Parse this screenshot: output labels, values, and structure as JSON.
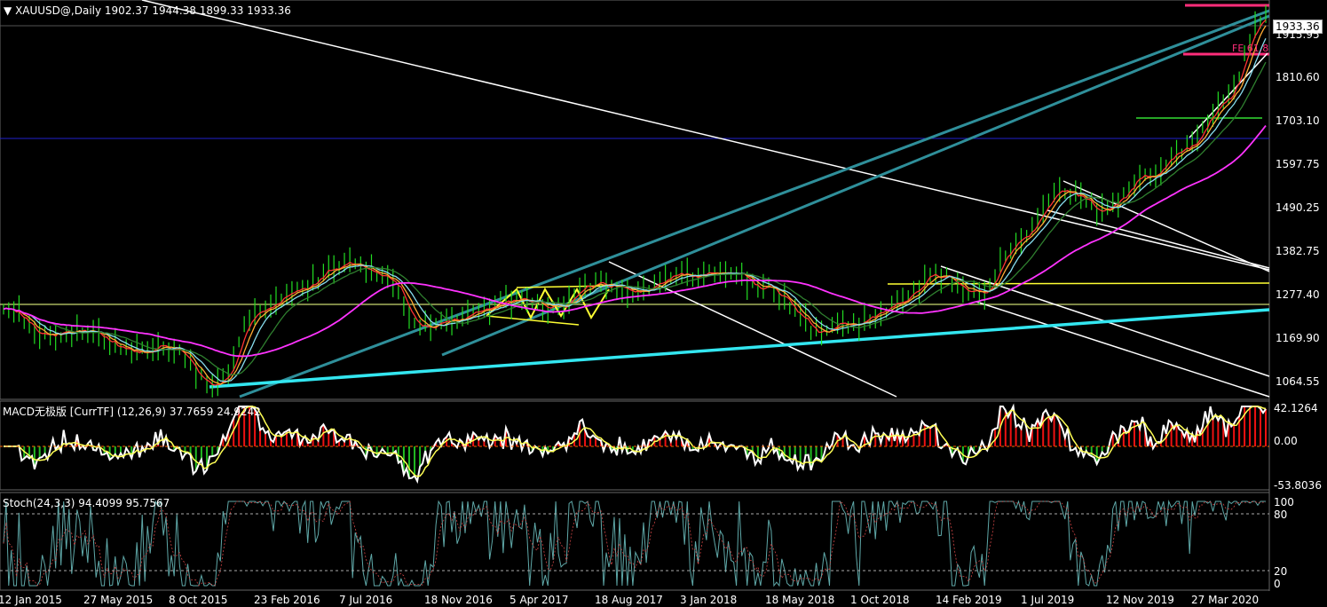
{
  "header": {
    "symbol_line": "XAUUSD@,Daily  1902.37 1944.38 1899.33 1933.36",
    "macd_label": "MACD无极版 [CurrTF] (12,26,9) 37.7659 24.9242",
    "stoch_label": "Stoch(24,3,3) 94.4099 95.7567"
  },
  "price_panel": {
    "last_price_tag": "1933.36",
    "axis_labels": [
      "1915.95",
      "1810.60",
      "1703.10",
      "1597.75",
      "1490.25",
      "1382.75",
      "1277.40",
      "1169.90",
      "1064.55"
    ],
    "fe_label": "FE 61.8"
  },
  "macd_panel": {
    "axis_labels": [
      "42.1264",
      "0.00",
      "-53.8036"
    ]
  },
  "stoch_panel": {
    "axis_labels": [
      "100",
      "80",
      "20",
      "0"
    ]
  },
  "time_axis": [
    "12 Jan 2015",
    "27 May 2015",
    "8 Oct 2015",
    "23 Feb 2016",
    "7 Jul 2016",
    "18 Nov 2016",
    "5 Apr 2017",
    "18 Aug 2017",
    "3 Jan 2018",
    "18 May 2018",
    "1 Oct 2018",
    "14 Feb 2019",
    "1 Jul 2019",
    "12 Nov 2019",
    "27 Mar 2020"
  ],
  "colors": {
    "background": "#000000",
    "candle_up": "#22dd22",
    "ma_magenta": "#ff33ff",
    "trend_white": "#ffffff",
    "channel_teal": "#2f8f9a",
    "support_cyan": "#33e6f0",
    "level_yellow": "#ffff33",
    "level_blue": "#2222cc",
    "fe_pink": "#ff2d7a",
    "macd_hist_pos": "#ee1111",
    "macd_hist_neg": "#22bb22",
    "stoch_line": "#5fa8a8"
  },
  "chart_data": {
    "type": "line",
    "symbol": "XAUUSD",
    "timeframe": "Daily",
    "ohlc_last": {
      "open": 1902.37,
      "high": 1944.38,
      "low": 1899.33,
      "close": 1933.36
    },
    "x": [
      "2015-01-12",
      "2015-03-15",
      "2015-05-27",
      "2015-08-01",
      "2015-10-08",
      "2015-12-17",
      "2016-02-23",
      "2016-05-01",
      "2016-07-07",
      "2016-09-10",
      "2016-11-18",
      "2017-01-25",
      "2017-04-05",
      "2017-06-15",
      "2017-08-18",
      "2017-10-25",
      "2018-01-03",
      "2018-03-10",
      "2018-05-18",
      "2018-08-15",
      "2018-10-01",
      "2018-12-10",
      "2019-02-14",
      "2019-04-25",
      "2019-07-01",
      "2019-09-05",
      "2019-11-12",
      "2020-01-20",
      "2020-03-27",
      "2020-05-20",
      "2020-07-27"
    ],
    "series": [
      {
        "values": [
          1255,
          1180,
          1195,
          1140,
          1150,
          1060,
          1230,
          1290,
          1350,
          1320,
          1200,
          1225,
          1260,
          1250,
          1300,
          1285,
          1315,
          1330,
          1290,
          1190,
          1200,
          1250,
          1320,
          1280,
          1410,
          1520,
          1470,
          1560,
          1620,
          1730,
          1933
        ]
      }
    ],
    "ylim": [
      1040,
      1945
    ],
    "ytick_labels": [
      "1915.95",
      "1810.60",
      "1703.10",
      "1597.75",
      "1490.25",
      "1382.75",
      "1277.40",
      "1169.90",
      "1064.55"
    ],
    "macd": {
      "params": "(12,26,9)",
      "main": 37.7659,
      "signal": 24.9242,
      "ylim": [
        -53.8036,
        42.1264
      ]
    },
    "stoch": {
      "params": "(24,3,3)",
      "k": 94.4099,
      "d": 95.7567,
      "levels": [
        20,
        80
      ],
      "ylim": [
        0,
        100
      ]
    }
  }
}
